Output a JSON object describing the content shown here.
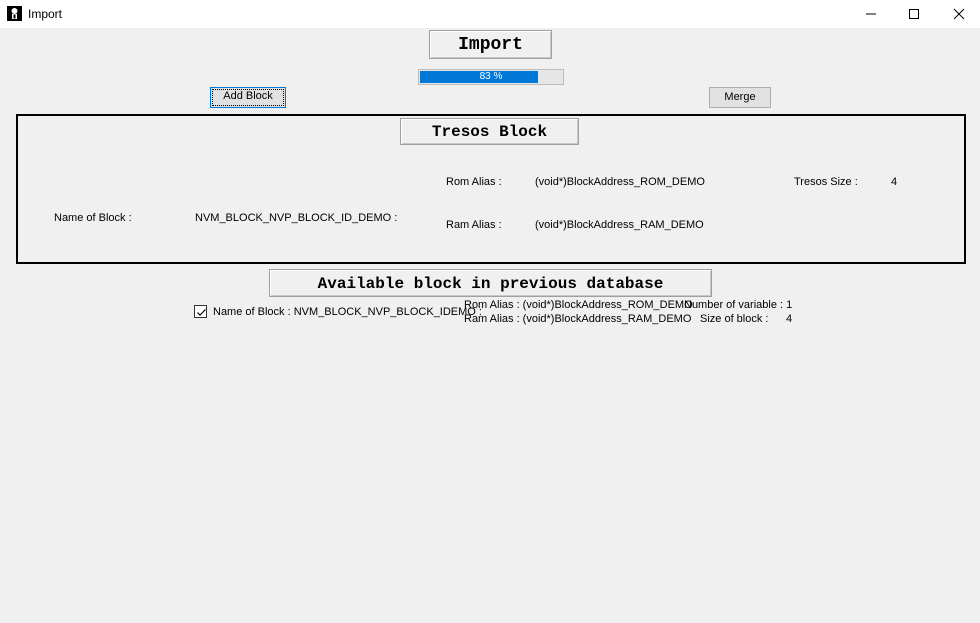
{
  "window": {
    "title": "Import"
  },
  "icons": {
    "app": "app-icon",
    "minimize": "minimize-icon",
    "maximize": "maximize-icon",
    "close": "close-icon",
    "checkmark": "checkmark-icon"
  },
  "colors": {
    "progress_fill": "#0078d7",
    "background": "#f0f0f0"
  },
  "header": {
    "title": "Import",
    "progress_value": 83,
    "progress_text": "83 %"
  },
  "toolbar": {
    "add_block_label": "Add Block",
    "merge_label": "Merge"
  },
  "tresos_block": {
    "title": "Tresos Block",
    "rom_alias_label": "Rom Alias :",
    "rom_alias_value": "(void*)BlockAddress_ROM_DEMO",
    "tresos_size_label": "Tresos Size :",
    "tresos_size_value": "4",
    "name_label": "Name of Block :",
    "name_value": "NVM_BLOCK_NVP_BLOCK_ID_DEMO :",
    "ram_alias_label": "Ram Alias :",
    "ram_alias_value": "(void*)BlockAddress_RAM_DEMO"
  },
  "available": {
    "title": "Available block in previous database",
    "items": [
      {
        "checked": true,
        "name_text": "Name of Block : NVM_BLOCK_NVP_BLOCK_IDEMO :",
        "rom_alias_text": "Rom Alias : (void*)BlockAddress_ROM_DEMO",
        "ram_alias_text": "Ram Alias : (void*)BlockAddress_RAM_DEMO",
        "num_variable_text": "Number of variable : 1",
        "size_label": "Size of block :",
        "size_value": "4"
      }
    ]
  }
}
